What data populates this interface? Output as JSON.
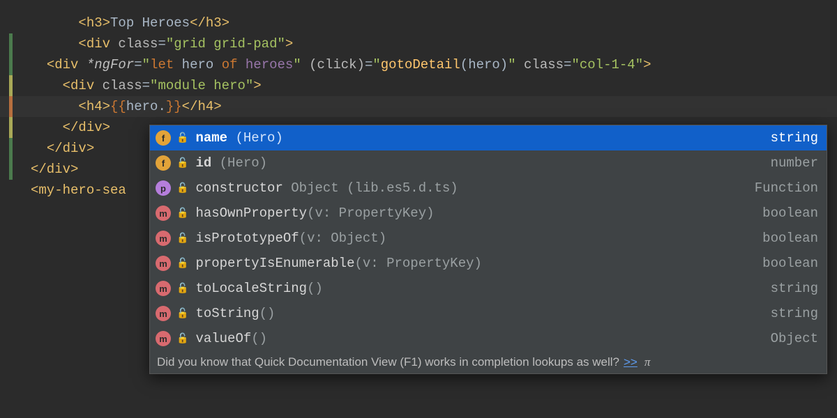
{
  "code": {
    "line1": {
      "tag_open": "<h3>",
      "text": "Top Heroes",
      "tag_close": "</h3>"
    },
    "line2": {
      "tag_open": "<div",
      "attr": " class",
      "eq": "=",
      "q": "\"",
      "v": "grid grid-pad",
      "close": ">"
    },
    "line3": {
      "tag_open": "<div",
      "dir": " *ngFor",
      "eq": "=",
      "q": "\"",
      "kw": "let ",
      "ident": "hero ",
      "kw2": "of ",
      "coll": "heroes",
      "q2": "\"",
      " ev_open": " (click)",
      "eq2": "=",
      "q3": "\"",
      "fn": "gotoDetail",
      "paren": "(hero)",
      "q4": "\"",
      " cls": " class",
      "eq3": "=",
      "q5": "\"",
      "cv": "col-1-4",
      "q6": "\"",
      "gt": ">"
    },
    "line4": {
      "tag_open": "<div",
      "attr": " class",
      "eq": "=",
      "q": "\"",
      "v": "module hero",
      "q2": "\"",
      "gt": ">"
    },
    "line5": {
      "tag_open": "<h4>",
      "i_open": "{{",
      "expr": "hero.",
      "i_close": "}}",
      "tag_close": "</h4>"
    },
    "line6": {
      "tag": "</div>"
    },
    "line7": {
      "tag": "</div>"
    },
    "line8": {
      "tag": "</div>"
    },
    "line9": {
      "tag": "<my-hero-sea"
    }
  },
  "gutter_colors": [
    "",
    "#4b7a4d",
    "#4b7a4d",
    "#a9a957",
    "#b76f3e",
    "#a9a957",
    "#4b7a4d",
    "#4b7a4d",
    ""
  ],
  "completion": {
    "items": [
      {
        "kind": "f",
        "name": "name",
        "extra": " (Hero)",
        "type": "string",
        "selected": true
      },
      {
        "kind": "f",
        "name": "id",
        "extra": " (Hero)",
        "type": "number"
      },
      {
        "kind": "p",
        "name": "constructor",
        "extra": " Object (lib.es5.d.ts)",
        "type": "Function"
      },
      {
        "kind": "m",
        "name": "hasOwnProperty",
        "extra": "(v: PropertyKey)",
        "type": "boolean"
      },
      {
        "kind": "m",
        "name": "isPrototypeOf",
        "extra": "(v: Object)",
        "type": "boolean"
      },
      {
        "kind": "m",
        "name": "propertyIsEnumerable",
        "extra": "(v: PropertyKey)",
        "type": "boolean"
      },
      {
        "kind": "m",
        "name": "toLocaleString",
        "extra": "()",
        "type": "string"
      },
      {
        "kind": "m",
        "name": "toString",
        "extra": "()",
        "type": "string"
      },
      {
        "kind": "m",
        "name": "valueOf",
        "extra": "()",
        "type": "Object"
      }
    ],
    "hint": "Did you know that Quick Documentation View (F1) works in completion lookups as well?",
    "hint_link": ">>",
    "hint_pi": "π"
  }
}
